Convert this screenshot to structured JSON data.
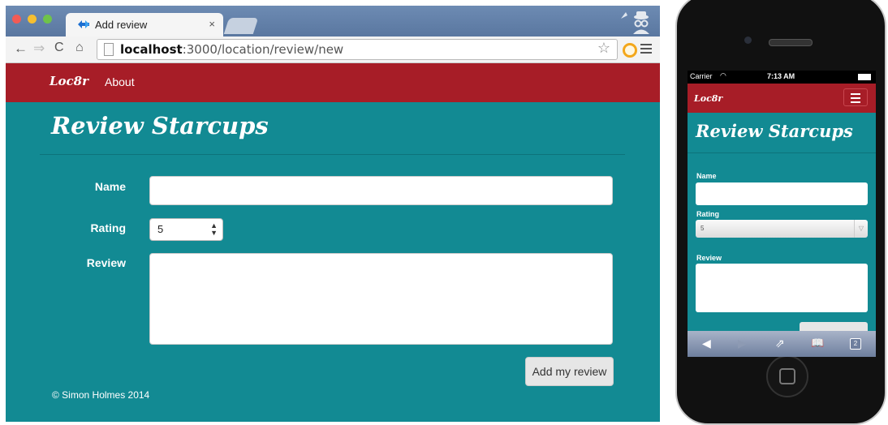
{
  "browser": {
    "tab_title": "Add review",
    "tab_close": "×",
    "url_host": "localhost",
    "url_path": ":3000/location/review/new"
  },
  "site": {
    "brand": "Loc8r",
    "nav": {
      "about": "About"
    },
    "heading": "Review Starcups",
    "form": {
      "name_label": "Name",
      "name_value": "",
      "rating_label": "Rating",
      "rating_value": "5",
      "review_label": "Review",
      "review_value": "",
      "submit_label": "Add my review"
    },
    "footer": "© Simon Holmes 2014"
  },
  "phone": {
    "carrier": "Carrier",
    "time": "7:13 AM",
    "brand": "Loc8r",
    "heading": "Review Starcups",
    "name_label": "Name",
    "rating_label": "Rating",
    "rating_value": "5",
    "review_label": "Review",
    "tabs_count": "2"
  },
  "colors": {
    "navbar": "#a71d27",
    "page_background": "#128a93",
    "chrome_tabstrip": "#5a77a0"
  },
  "icons": {
    "back": "back-arrow-icon",
    "forward": "forward-arrow-icon",
    "reload": "reload-icon",
    "home": "home-icon",
    "bookmark": "star-icon",
    "menu": "hamburger-menu-icon",
    "incognito": "incognito-icon"
  }
}
